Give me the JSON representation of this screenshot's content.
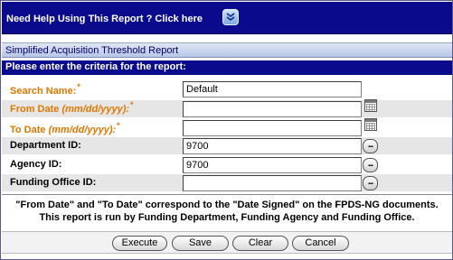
{
  "help": {
    "label": "Need Help Using This Report ? Click here",
    "icon": "chevron-down-circle-icon"
  },
  "report": {
    "title": "Simplified Acquisition Threshold Report",
    "instruction": "Please enter the criteria for the report:"
  },
  "form": {
    "search_name": {
      "label": "Search Name:",
      "required_mark": "*",
      "value": "Default"
    },
    "from_date": {
      "label": "From Date",
      "format": "(mm/dd/yyyy):",
      "required_mark": "*",
      "value": ""
    },
    "to_date": {
      "label": "To Date",
      "format": "(mm/dd/yyyy):",
      "required_mark": "*",
      "value": ""
    },
    "department_id": {
      "label": "Department ID:",
      "value": "9700",
      "lookup": "..."
    },
    "agency_id": {
      "label": "Agency ID:",
      "value": "9700",
      "lookup": "..."
    },
    "funding_office_id": {
      "label": "Funding Office ID:",
      "value": "",
      "lookup": "..."
    }
  },
  "note": {
    "line1": "\"From Date\" and \"To Date\" correspond to the \"Date Signed\" on the FPDS-NG documents.",
    "line2": "This report is run by Funding Department, Funding Agency and Funding Office."
  },
  "buttons": {
    "execute": "Execute",
    "save": "Save",
    "clear": "Clear",
    "cancel": "Cancel"
  },
  "colors": {
    "header_blue": "#0a0a8c",
    "label_orange": "#e07800",
    "title_text": "#00006a"
  }
}
